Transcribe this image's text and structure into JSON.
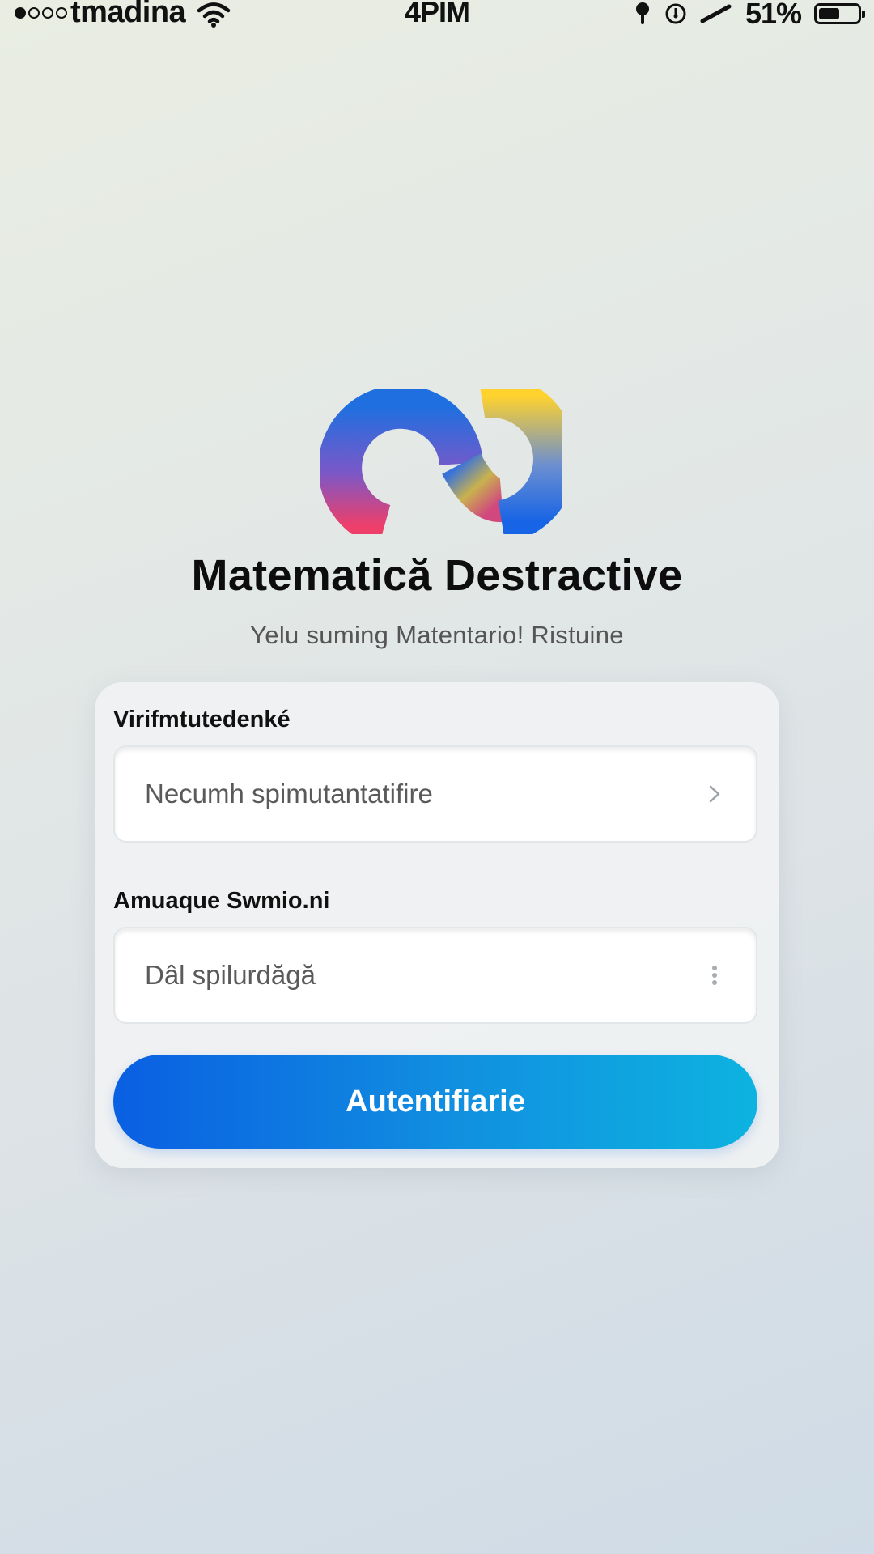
{
  "status_bar": {
    "carrier": "tmadina",
    "time": "4PIM",
    "battery_text": "51%",
    "battery_level": 0.55,
    "icons": [
      "signal-dots-icon",
      "wifi-icon",
      "location-icon",
      "alarm-icon",
      "link-icon",
      "battery-icon"
    ]
  },
  "header": {
    "title": "Matematică Destractive",
    "subtitle": "Yelu suming Matentario! Ristuine"
  },
  "form": {
    "field1": {
      "label": "Virifmtutedenké",
      "placeholder": "Necumh spimutantatifire",
      "value": "",
      "icon": "chevron-right-icon"
    },
    "field2": {
      "label": "Amuaque Swmio.ni",
      "placeholder": "Dâl spilurdăgă",
      "value": "",
      "icon": "more-vertical-icon"
    },
    "submit_label": "Autentifiarie"
  },
  "colors": {
    "button_start": "#0a5fe2",
    "button_end": "#0db3e0",
    "background": "#e4e9e6"
  }
}
